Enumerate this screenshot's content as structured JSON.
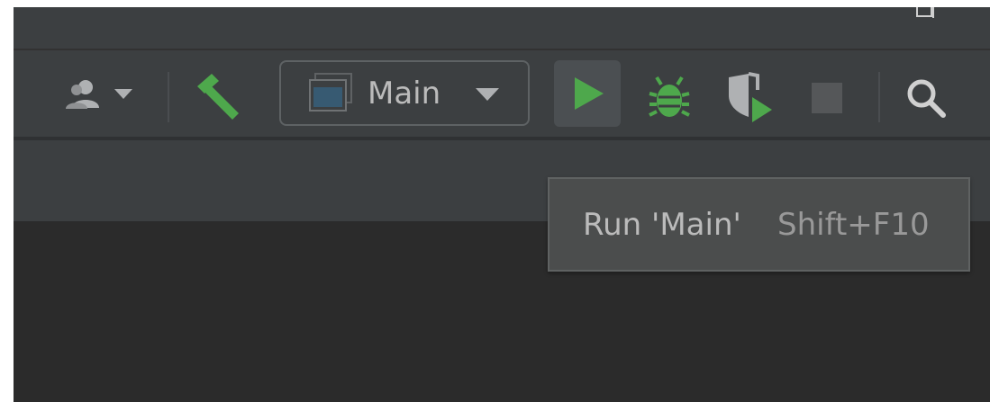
{
  "toolbar": {
    "run_config": {
      "label": "Main"
    },
    "icons": {
      "vcs_user": "users-dropdown-icon",
      "build": "hammer-icon",
      "run": "play-icon",
      "debug": "bug-icon",
      "coverage": "coverage-icon",
      "stop": "stop-icon",
      "search": "search-icon"
    }
  },
  "tooltip": {
    "text": "Run 'Main'",
    "shortcut": "Shift+F10"
  },
  "colors": {
    "background": "#2b2b2b",
    "toolbar": "#3c3f41",
    "accent_green": "#4ea84c",
    "text": "#bbbbbb",
    "tooltip_bg": "#4b4d4d"
  }
}
